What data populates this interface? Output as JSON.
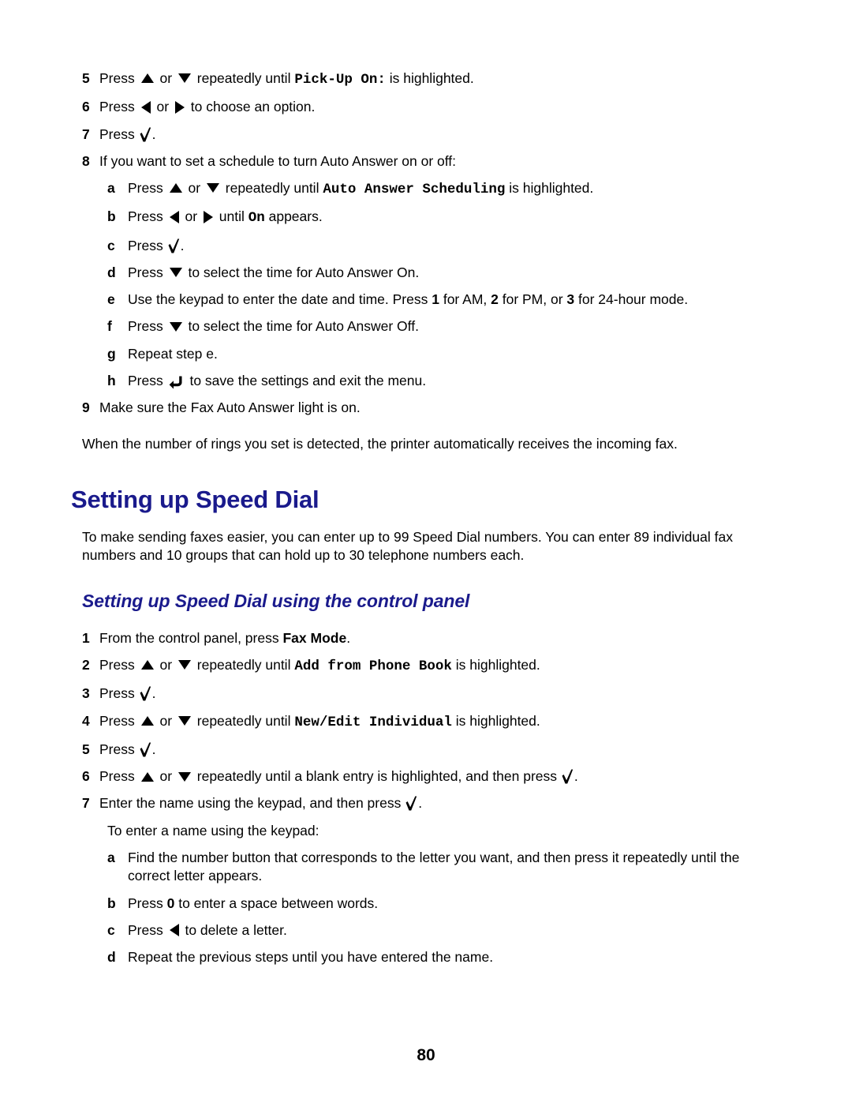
{
  "document": {
    "page_number": "80",
    "section_heading": "Setting up Speed Dial",
    "subsection_heading": "Setting up Speed Dial using the control panel",
    "accent_color": "#1a1a8c"
  },
  "top_steps": [
    {
      "marker": "5",
      "parts": [
        {
          "t": "text",
          "v": "Press "
        },
        {
          "t": "icon",
          "v": "arrow-up-icon"
        },
        {
          "t": "text",
          "v": " or "
        },
        {
          "t": "icon",
          "v": "arrow-down-icon"
        },
        {
          "t": "text",
          "v": " repeatedly until "
        },
        {
          "t": "mono",
          "v": "Pick-Up On:"
        },
        {
          "t": "text",
          "v": " is highlighted."
        }
      ]
    },
    {
      "marker": "6",
      "parts": [
        {
          "t": "text",
          "v": "Press "
        },
        {
          "t": "icon",
          "v": "arrow-left-icon"
        },
        {
          "t": "text",
          "v": " or "
        },
        {
          "t": "icon",
          "v": "arrow-right-icon"
        },
        {
          "t": "text",
          "v": " to choose an option."
        }
      ]
    },
    {
      "marker": "7",
      "parts": [
        {
          "t": "text",
          "v": "Press "
        },
        {
          "t": "icon",
          "v": "check-icon"
        },
        {
          "t": "text",
          "v": "."
        }
      ]
    },
    {
      "marker": "8",
      "parts": [
        {
          "t": "text",
          "v": "If you want to set a schedule to turn Auto Answer on or off:"
        }
      ]
    }
  ],
  "substeps_8": [
    {
      "marker": "a",
      "parts": [
        {
          "t": "text",
          "v": "Press "
        },
        {
          "t": "icon",
          "v": "arrow-up-icon"
        },
        {
          "t": "text",
          "v": " or "
        },
        {
          "t": "icon",
          "v": "arrow-down-icon"
        },
        {
          "t": "text",
          "v": " repeatedly until "
        },
        {
          "t": "mono",
          "v": "Auto Answer Scheduling"
        },
        {
          "t": "text",
          "v": " is highlighted."
        }
      ]
    },
    {
      "marker": "b",
      "parts": [
        {
          "t": "text",
          "v": "Press "
        },
        {
          "t": "icon",
          "v": "arrow-left-icon"
        },
        {
          "t": "text",
          "v": " or "
        },
        {
          "t": "icon",
          "v": "arrow-right-icon"
        },
        {
          "t": "text",
          "v": " until "
        },
        {
          "t": "mono",
          "v": "On"
        },
        {
          "t": "text",
          "v": " appears."
        }
      ]
    },
    {
      "marker": "c",
      "parts": [
        {
          "t": "text",
          "v": "Press "
        },
        {
          "t": "icon",
          "v": "check-icon"
        },
        {
          "t": "text",
          "v": "."
        }
      ]
    },
    {
      "marker": "d",
      "parts": [
        {
          "t": "text",
          "v": "Press "
        },
        {
          "t": "icon",
          "v": "arrow-down-icon"
        },
        {
          "t": "text",
          "v": " to select the time for Auto Answer On."
        }
      ]
    },
    {
      "marker": "e",
      "parts": [
        {
          "t": "text",
          "v": "Use the keypad to enter the date and time. Press "
        },
        {
          "t": "bold",
          "v": "1"
        },
        {
          "t": "text",
          "v": " for AM, "
        },
        {
          "t": "bold",
          "v": "2"
        },
        {
          "t": "text",
          "v": " for PM, or "
        },
        {
          "t": "bold",
          "v": "3"
        },
        {
          "t": "text",
          "v": " for 24-hour mode."
        }
      ]
    },
    {
      "marker": "f",
      "parts": [
        {
          "t": "text",
          "v": "Press "
        },
        {
          "t": "icon",
          "v": "arrow-down-icon"
        },
        {
          "t": "text",
          "v": " to select the time for Auto Answer Off."
        }
      ]
    },
    {
      "marker": "g",
      "parts": [
        {
          "t": "text",
          "v": "Repeat step e."
        }
      ]
    },
    {
      "marker": "h",
      "parts": [
        {
          "t": "text",
          "v": "Press "
        },
        {
          "t": "icon",
          "v": "back-arrow-icon"
        },
        {
          "t": "text",
          "v": " to save the settings and exit the menu."
        }
      ]
    }
  ],
  "step_9": {
    "marker": "9",
    "parts": [
      {
        "t": "text",
        "v": "Make sure the Fax Auto Answer light is on."
      }
    ]
  },
  "closing_paragraph": "When the number of rings you set is detected, the printer automatically receives the incoming fax.",
  "section_intro": "To make sending faxes easier, you can enter up to 99 Speed Dial numbers. You can enter 89 individual fax numbers and 10 groups that can hold up to 30 telephone numbers each.",
  "speed_dial_steps": [
    {
      "marker": "1",
      "parts": [
        {
          "t": "text",
          "v": "From the control panel, press "
        },
        {
          "t": "bold",
          "v": "Fax Mode"
        },
        {
          "t": "text",
          "v": "."
        }
      ]
    },
    {
      "marker": "2",
      "parts": [
        {
          "t": "text",
          "v": "Press "
        },
        {
          "t": "icon",
          "v": "arrow-up-icon"
        },
        {
          "t": "text",
          "v": " or "
        },
        {
          "t": "icon",
          "v": "arrow-down-icon"
        },
        {
          "t": "text",
          "v": " repeatedly until "
        },
        {
          "t": "mono",
          "v": "Add from Phone Book"
        },
        {
          "t": "text",
          "v": " is highlighted."
        }
      ]
    },
    {
      "marker": "3",
      "parts": [
        {
          "t": "text",
          "v": "Press "
        },
        {
          "t": "icon",
          "v": "check-icon"
        },
        {
          "t": "text",
          "v": "."
        }
      ]
    },
    {
      "marker": "4",
      "parts": [
        {
          "t": "text",
          "v": "Press "
        },
        {
          "t": "icon",
          "v": "arrow-up-icon"
        },
        {
          "t": "text",
          "v": " or "
        },
        {
          "t": "icon",
          "v": "arrow-down-icon"
        },
        {
          "t": "text",
          "v": " repeatedly until "
        },
        {
          "t": "mono",
          "v": "New/Edit Individual"
        },
        {
          "t": "text",
          "v": " is highlighted."
        }
      ]
    },
    {
      "marker": "5",
      "parts": [
        {
          "t": "text",
          "v": "Press "
        },
        {
          "t": "icon",
          "v": "check-icon"
        },
        {
          "t": "text",
          "v": "."
        }
      ]
    },
    {
      "marker": "6",
      "parts": [
        {
          "t": "text",
          "v": "Press "
        },
        {
          "t": "icon",
          "v": "arrow-up-icon"
        },
        {
          "t": "text",
          "v": " or "
        },
        {
          "t": "icon",
          "v": "arrow-down-icon"
        },
        {
          "t": "text",
          "v": " repeatedly until a blank entry is highlighted, and then press "
        },
        {
          "t": "icon",
          "v": "check-icon"
        },
        {
          "t": "text",
          "v": "."
        }
      ]
    },
    {
      "marker": "7",
      "parts": [
        {
          "t": "text",
          "v": "Enter the name using the keypad, and then press "
        },
        {
          "t": "icon",
          "v": "check-icon"
        },
        {
          "t": "text",
          "v": "."
        }
      ]
    }
  ],
  "keypad_note": "To enter a name using the keypad:",
  "keypad_substeps": [
    {
      "marker": "a",
      "parts": [
        {
          "t": "text",
          "v": "Find the number button that corresponds to the letter you want, and then press it repeatedly until the correct letter appears."
        }
      ]
    },
    {
      "marker": "b",
      "parts": [
        {
          "t": "text",
          "v": "Press "
        },
        {
          "t": "bold",
          "v": "0"
        },
        {
          "t": "text",
          "v": " to enter a space between words."
        }
      ]
    },
    {
      "marker": "c",
      "parts": [
        {
          "t": "text",
          "v": "Press "
        },
        {
          "t": "icon",
          "v": "arrow-left-icon"
        },
        {
          "t": "text",
          "v": " to delete a letter."
        }
      ]
    },
    {
      "marker": "d",
      "parts": [
        {
          "t": "text",
          "v": "Repeat the previous steps until you have entered the name."
        }
      ]
    }
  ]
}
